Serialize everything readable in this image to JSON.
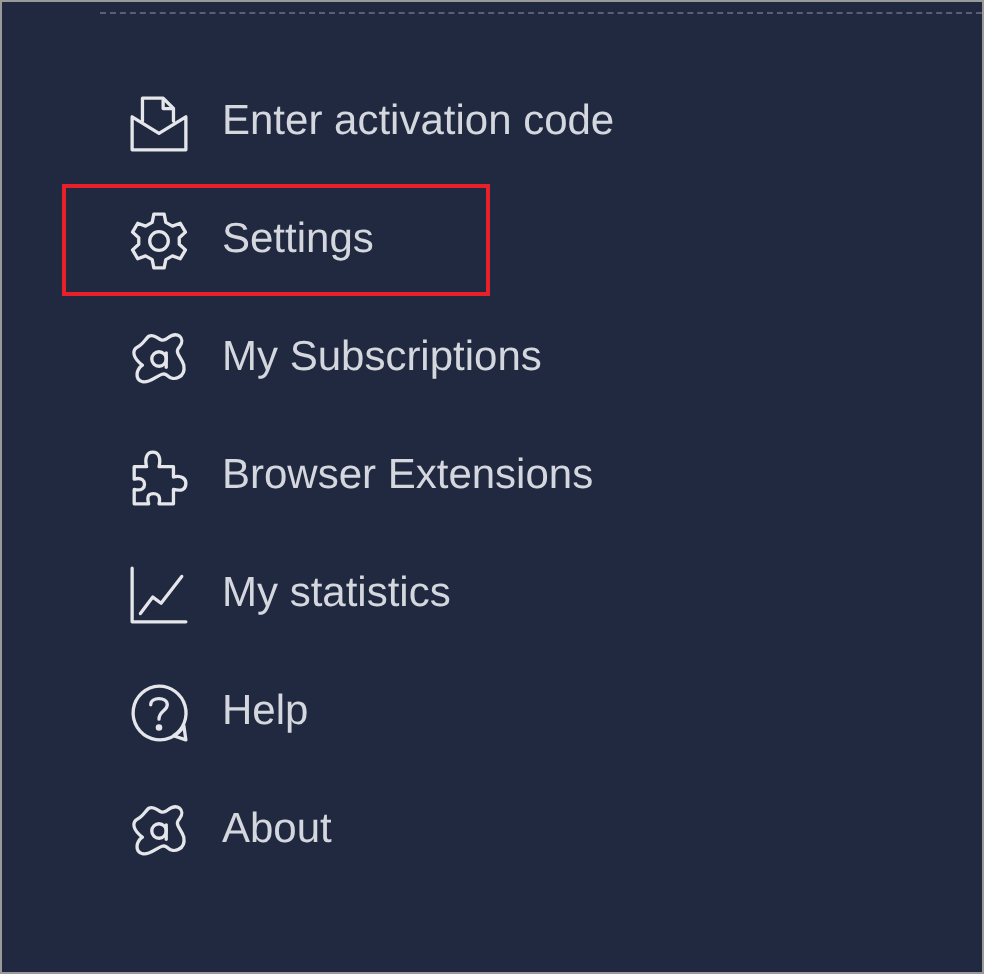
{
  "menu": {
    "items": [
      {
        "kind": "envelope",
        "label": "Enter activation code",
        "highlighted": false
      },
      {
        "kind": "gear",
        "label": "Settings",
        "highlighted": true
      },
      {
        "kind": "splat",
        "label": "My Subscriptions",
        "highlighted": false
      },
      {
        "kind": "puzzle",
        "label": "Browser Extensions",
        "highlighted": false
      },
      {
        "kind": "chart",
        "label": "My statistics",
        "highlighted": false
      },
      {
        "kind": "help",
        "label": "Help",
        "highlighted": false
      },
      {
        "kind": "splat",
        "label": "About",
        "highlighted": false
      }
    ]
  }
}
